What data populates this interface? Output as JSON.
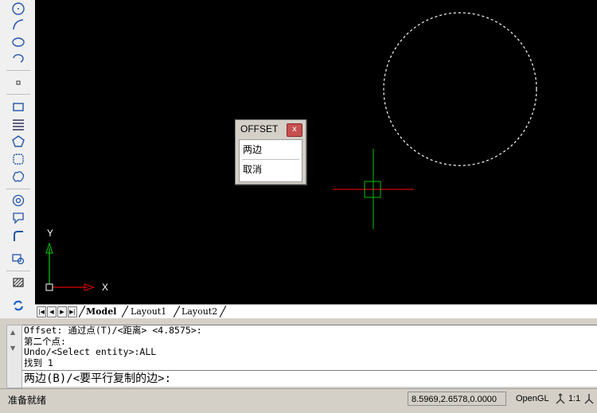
{
  "toolbar": {
    "tools": [
      {
        "icon": "circle-tool-icon"
      },
      {
        "icon": "arc-tool-icon"
      },
      {
        "icon": "ellipse-tool-icon"
      },
      {
        "icon": "ellipse-arc-tool-icon"
      },
      {
        "icon": "point-tool-icon"
      },
      {
        "icon": "rectangle-tool-icon"
      },
      {
        "icon": "multiline-tool-icon"
      },
      {
        "icon": "polygon-tool-icon"
      },
      {
        "icon": "region-tool-icon"
      },
      {
        "icon": "revision-cloud-tool-icon"
      },
      {
        "icon": "donut-tool-icon"
      },
      {
        "icon": "leader-tool-icon"
      },
      {
        "icon": "pipe-tool-icon"
      },
      {
        "icon": "insert-block-tool-icon"
      },
      {
        "icon": "hatch-tool-icon"
      },
      {
        "icon": "refresh-tool-icon"
      }
    ]
  },
  "offset_dialog": {
    "title": "OFFSET",
    "close_label": "x",
    "items": [
      "两边",
      "取消"
    ]
  },
  "axes": {
    "x_label": "X",
    "y_label": "Y"
  },
  "tabs": {
    "items": [
      {
        "label": "Model",
        "active": true
      },
      {
        "label": "Layout1",
        "active": false
      },
      {
        "label": "Layout2",
        "active": false
      }
    ]
  },
  "command": {
    "history": [
      "Offset: 通过点(T)/<距离> <4.8575>:",
      "第二个点:",
      "Undo/<Select entity>:ALL",
      "找到 1"
    ],
    "prompt": "两边(B)/<要平行复制的边>:"
  },
  "status": {
    "text": "准备就绪",
    "coords": "8.5969,2.6578,0.0000",
    "renderer": "OpenGL",
    "scale": "1:1"
  },
  "colors": {
    "canvas": "#000000",
    "crosshair_h": "#ff0000",
    "crosshair_v": "#00c000",
    "circle_dashed": "#ffffff"
  }
}
